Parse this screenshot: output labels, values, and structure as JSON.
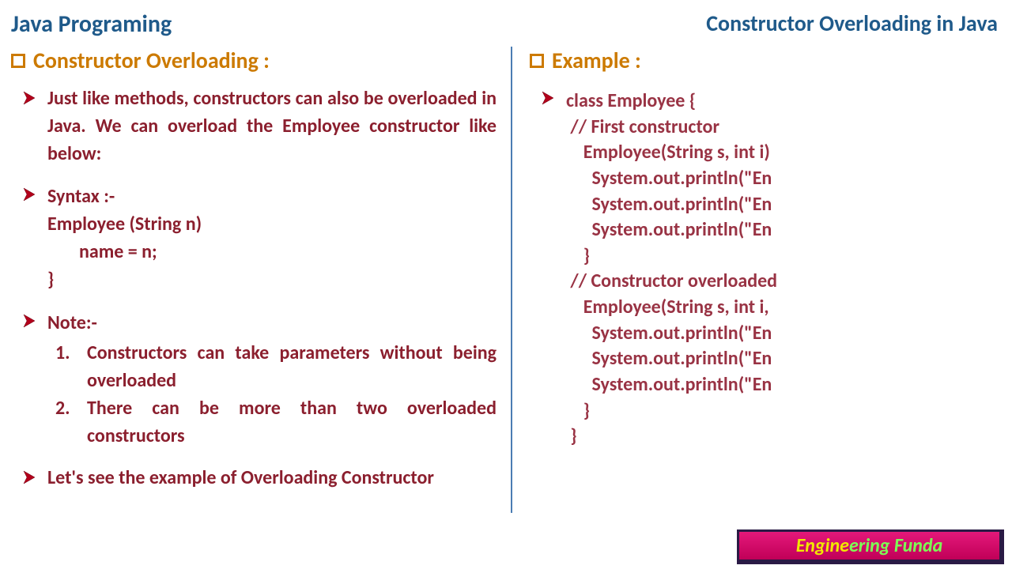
{
  "header": {
    "left": "Java Programing",
    "right": "Constructor Overloading in Java"
  },
  "leftCol": {
    "heading": "Constructor Overloading :",
    "intro": "Just like methods, constructors can also be overloaded in Java. We can overload the Employee constructor like below:",
    "syntaxLabel": "Syntax :-",
    "syntaxLine1": "Employee (String n)",
    "syntaxLine2": "name = n;",
    "syntaxLine3": "}",
    "noteLabel": "Note:-",
    "note1": "Constructors can take parameters without being overloaded",
    "note2": "There can be more than two overloaded constructors",
    "closing": "Let's see the example of Overloading Constructor"
  },
  "rightCol": {
    "heading": "Example :",
    "code": "class Employee {\n // First constructor\n    Employee(String s, int i)\n      System.out.println(\"En\n      System.out.println(\"En\n      System.out.println(\"En\n    }\n // Constructor overloaded\n    Employee(String s, int i,\n      System.out.println(\"En\n      System.out.println(\"En\n      System.out.println(\"En\n    }\n }"
  },
  "logo": {
    "part1": "Engine",
    "part2": "ering Funda"
  }
}
